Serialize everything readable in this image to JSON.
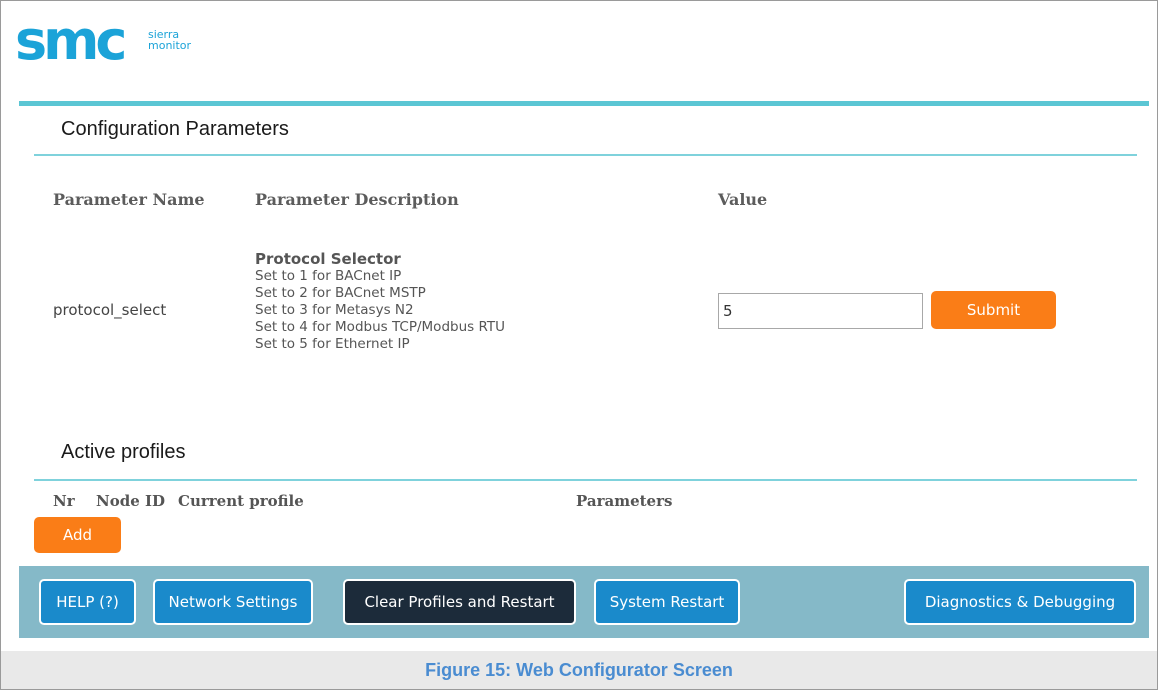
{
  "logo": {
    "letters": "smc",
    "line1": "sierra",
    "line2": "monitor",
    "color": "#1ba3d8"
  },
  "config": {
    "title": "Configuration Parameters",
    "headers": {
      "name": "Parameter Name",
      "description": "Parameter Description",
      "value": "Value"
    },
    "row": {
      "name": "protocol_select",
      "desc_title": "Protocol Selector",
      "desc_lines": [
        "Set to 1 for BACnet IP",
        "Set to 2 for BACnet MSTP",
        "Set to 3 for Metasys N2",
        "Set to 4 for Modbus TCP/Modbus RTU",
        "Set to 5 for Ethernet IP"
      ],
      "value": "5",
      "submit_label": "Submit"
    }
  },
  "profiles": {
    "title": "Active profiles",
    "headers": {
      "nr": "Nr",
      "node_id": "Node ID",
      "current_profile": "Current profile",
      "parameters": "Parameters"
    },
    "add_label": "Add"
  },
  "nav": {
    "help": "HELP (?)",
    "network": "Network Settings",
    "clear": "Clear Profiles and Restart",
    "restart": "System Restart",
    "diagnostics": "Diagnostics & Debugging"
  },
  "caption": "Figure 15: Web Configurator Screen",
  "colors": {
    "accent": "#5bc6d4",
    "orange": "#fa7d17",
    "button_blue": "#1a8acb",
    "bar": "#85b9c8",
    "caption_blue": "#4a8cd1"
  }
}
